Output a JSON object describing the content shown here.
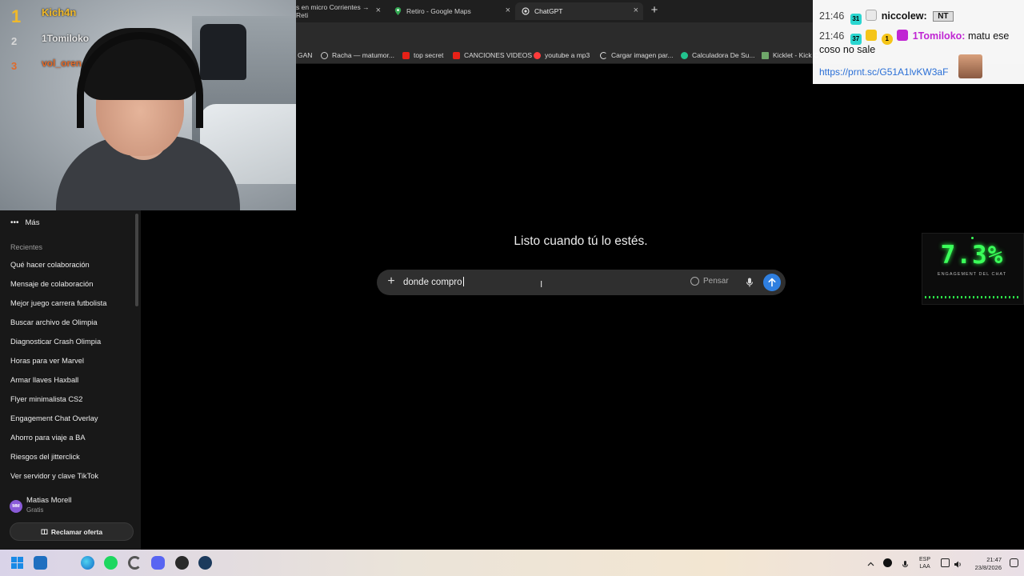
{
  "browser": {
    "tabs": [
      {
        "label": "s en micro Corrientes → Reti",
        "icon": "page-icon"
      },
      {
        "label": "Retiro - Google Maps",
        "icon": "maps-pin-icon"
      },
      {
        "label": "ChatGPT",
        "icon": "chatgpt-icon",
        "active": true
      }
    ],
    "close_glyph": "×",
    "new_tab_glyph": "+",
    "bookmarks": [
      {
        "label": "GAN",
        "icon": "none"
      },
      {
        "label": "Racha — matumor...",
        "icon": "globe-icon"
      },
      {
        "label": "top secret",
        "icon": "youtube-icon"
      },
      {
        "label": "CANCIONES VIDEOS",
        "icon": "youtube-icon"
      },
      {
        "label": "youtube a mp3",
        "icon": "red-circle-icon"
      },
      {
        "label": "Cargar imagen par...",
        "icon": "c-icon"
      },
      {
        "label": "Calculadora De Su...",
        "icon": "green-circle-icon"
      },
      {
        "label": "Kicklet - Kick C",
        "icon": "kicklet-icon"
      }
    ]
  },
  "webcam": {
    "leaderboard": [
      {
        "rank": "1",
        "name": "Kich4n",
        "color": "#f0b92a"
      },
      {
        "rank": "2",
        "name": "1Tomiloko",
        "color": "#d9d9d9"
      },
      {
        "rank": "3",
        "name": "vol_oren",
        "color": "#e06a2a"
      }
    ]
  },
  "chat": {
    "messages": [
      {
        "time": "21:46",
        "badges": [
          "31"
        ],
        "user": "niccolew:",
        "text": "",
        "user_color": "#111111"
      },
      {
        "time": "21:46",
        "badges": [
          "37",
          "1"
        ],
        "user": "1Tomiloko:",
        "text": "matu ese",
        "user_color": "#c026d3"
      }
    ],
    "continuation": "coso no sale",
    "badge_nt": "NT",
    "link": "https://prnt.sc/G51A1lvKW3aF"
  },
  "engagement": {
    "value": "7.3%",
    "label": "ENGAGEMENT DEL CHAT",
    "color": "#3bff5a"
  },
  "sidebar": {
    "more_label": "Más",
    "recents_heading": "Recientes",
    "conversations": [
      "Qué hacer colaboración",
      "Mensaje de colaboración",
      "Mejor juego carrera futbolista",
      "Buscar archivo de Olimpia",
      "Diagnosticar Crash Olimpia",
      "Horas para ver Marvel",
      "Armar llaves Haxball",
      "Flyer minimalista CS2",
      "Engagement Chat Overlay",
      "Ahorro para viaje a BA",
      "Riesgos del jitterclick",
      "Ver servidor y clave TikTok"
    ],
    "user": {
      "initials": "MM",
      "name": "Matias Morell",
      "plan": "Gratis"
    },
    "claim_offer_label": "Reclamar oferta"
  },
  "main": {
    "greeting": "Listo cuando tú lo estés.",
    "composer": {
      "value": "donde compro",
      "think_label": "Pensar",
      "send_color": "#2f7fe0"
    }
  },
  "taskbar": {
    "language": [
      "ESP",
      "LAA"
    ],
    "time": "21:47",
    "date": "23/8/2026"
  }
}
